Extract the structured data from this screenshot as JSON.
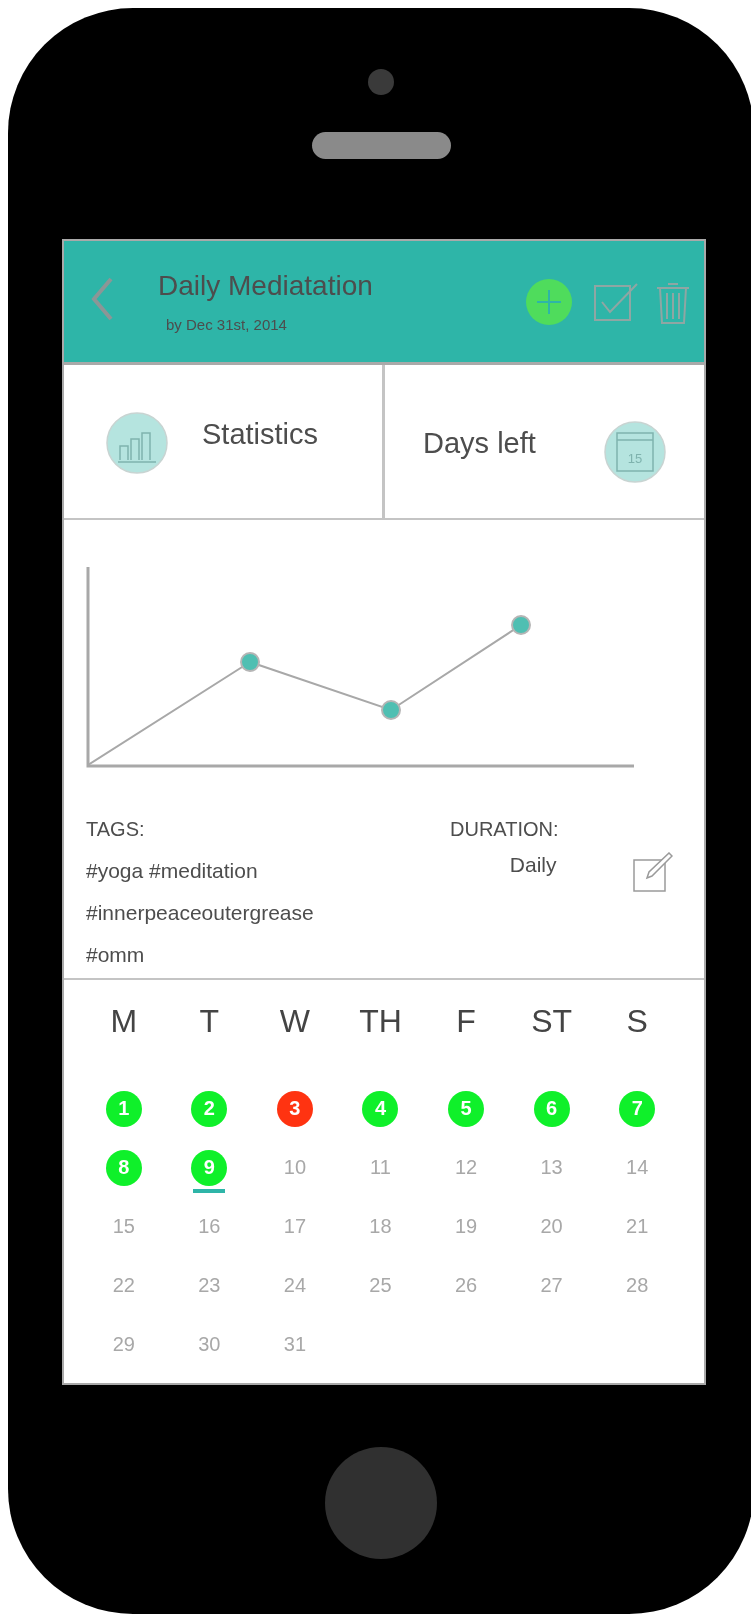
{
  "header": {
    "title": "Daily Mediatation",
    "subtitle": "by Dec 31st, 2014"
  },
  "stats": [
    {
      "kind": "statistics",
      "label": "Statistics"
    },
    {
      "kind": "calendar",
      "label": "Days left",
      "icon_text": "15"
    }
  ],
  "details": {
    "tags_label": "TAGS:",
    "tags": [
      "#yoga #meditation",
      "#innerpeaceoutergrease",
      "#omm"
    ],
    "duration_label": "DURATION:",
    "duration": "Daily"
  },
  "calendar": {
    "weekdays": [
      "M",
      "T",
      "W",
      "TH",
      "F",
      "ST",
      "S"
    ],
    "days": [
      {
        "label": "1",
        "color": "#0ff02a",
        "today": false
      },
      {
        "label": "2",
        "color": "#0ff02a",
        "today": false
      },
      {
        "label": "3",
        "color": "#ff3311",
        "today": false
      },
      {
        "label": "4",
        "color": "#0ff02a",
        "today": false
      },
      {
        "label": "5",
        "color": "#0ff02a",
        "today": false
      },
      {
        "label": "6",
        "color": "#0ff02a",
        "today": false
      },
      {
        "label": "7",
        "color": "#0ff02a",
        "today": false
      },
      {
        "label": "8",
        "color": "#0ff02a",
        "today": false
      },
      {
        "label": "9",
        "color": "#0ff02a",
        "today": true
      },
      {
        "label": "10",
        "today": false
      },
      {
        "label": "11",
        "today": false
      },
      {
        "label": "12",
        "today": false
      },
      {
        "label": "13",
        "today": false
      },
      {
        "label": "14",
        "today": false
      },
      {
        "label": "15",
        "today": false
      },
      {
        "label": "16",
        "today": false
      },
      {
        "label": "17",
        "today": false
      },
      {
        "label": "18",
        "today": false
      },
      {
        "label": "19",
        "today": false
      },
      {
        "label": "20",
        "today": false
      },
      {
        "label": "21",
        "today": false
      },
      {
        "label": "22",
        "today": false
      },
      {
        "label": "23",
        "today": false
      },
      {
        "label": "24",
        "today": false
      },
      {
        "label": "25",
        "today": false
      },
      {
        "label": "26",
        "today": false
      },
      {
        "label": "27",
        "today": false
      },
      {
        "label": "28",
        "today": false
      },
      {
        "label": "29",
        "today": false
      },
      {
        "label": "30",
        "today": false
      },
      {
        "label": "31",
        "today": false
      }
    ]
  }
}
